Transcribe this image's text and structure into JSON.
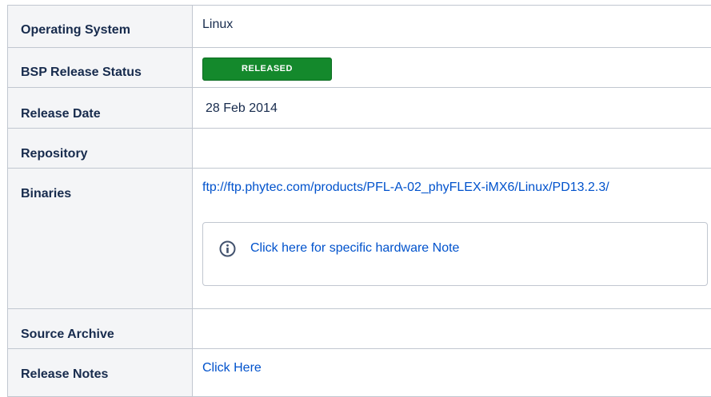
{
  "rows": [
    {
      "label": "Operating System",
      "value": "Linux"
    },
    {
      "label": "BSP Release Status",
      "badge": "RELEASED"
    },
    {
      "label": "Release Date",
      "value": "28 Feb 2014"
    },
    {
      "label": "Repository",
      "value": ""
    },
    {
      "label": "Binaries",
      "link": "ftp://ftp.phytec.com/products/PFL-A-02_phyFLEX-iMX6/Linux/PD13.2.3/"
    },
    {
      "label": "Source Archive",
      "value": ""
    },
    {
      "label": "Release Notes",
      "link": "Click Here"
    }
  ],
  "note": {
    "icon": "info-icon",
    "text": "Click here for specific hardware Note"
  },
  "colors": {
    "badge": "#14892c",
    "link": "#0052cc",
    "header_bg": "#f4f5f7",
    "border": "#c1c7d0"
  }
}
